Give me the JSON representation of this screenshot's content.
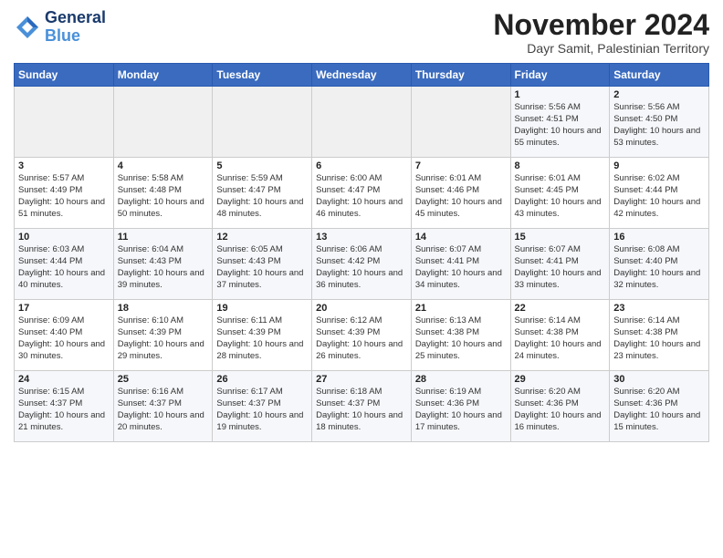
{
  "header": {
    "logo_line1": "General",
    "logo_line2": "Blue",
    "title": "November 2024",
    "subtitle": "Dayr Samit, Palestinian Territory"
  },
  "days_of_week": [
    "Sunday",
    "Monday",
    "Tuesday",
    "Wednesday",
    "Thursday",
    "Friday",
    "Saturday"
  ],
  "weeks": [
    [
      {
        "day": "",
        "info": ""
      },
      {
        "day": "",
        "info": ""
      },
      {
        "day": "",
        "info": ""
      },
      {
        "day": "",
        "info": ""
      },
      {
        "day": "",
        "info": ""
      },
      {
        "day": "1",
        "info": "Sunrise: 5:56 AM\nSunset: 4:51 PM\nDaylight: 10 hours and 55 minutes."
      },
      {
        "day": "2",
        "info": "Sunrise: 5:56 AM\nSunset: 4:50 PM\nDaylight: 10 hours and 53 minutes."
      }
    ],
    [
      {
        "day": "3",
        "info": "Sunrise: 5:57 AM\nSunset: 4:49 PM\nDaylight: 10 hours and 51 minutes."
      },
      {
        "day": "4",
        "info": "Sunrise: 5:58 AM\nSunset: 4:48 PM\nDaylight: 10 hours and 50 minutes."
      },
      {
        "day": "5",
        "info": "Sunrise: 5:59 AM\nSunset: 4:47 PM\nDaylight: 10 hours and 48 minutes."
      },
      {
        "day": "6",
        "info": "Sunrise: 6:00 AM\nSunset: 4:47 PM\nDaylight: 10 hours and 46 minutes."
      },
      {
        "day": "7",
        "info": "Sunrise: 6:01 AM\nSunset: 4:46 PM\nDaylight: 10 hours and 45 minutes."
      },
      {
        "day": "8",
        "info": "Sunrise: 6:01 AM\nSunset: 4:45 PM\nDaylight: 10 hours and 43 minutes."
      },
      {
        "day": "9",
        "info": "Sunrise: 6:02 AM\nSunset: 4:44 PM\nDaylight: 10 hours and 42 minutes."
      }
    ],
    [
      {
        "day": "10",
        "info": "Sunrise: 6:03 AM\nSunset: 4:44 PM\nDaylight: 10 hours and 40 minutes."
      },
      {
        "day": "11",
        "info": "Sunrise: 6:04 AM\nSunset: 4:43 PM\nDaylight: 10 hours and 39 minutes."
      },
      {
        "day": "12",
        "info": "Sunrise: 6:05 AM\nSunset: 4:43 PM\nDaylight: 10 hours and 37 minutes."
      },
      {
        "day": "13",
        "info": "Sunrise: 6:06 AM\nSunset: 4:42 PM\nDaylight: 10 hours and 36 minutes."
      },
      {
        "day": "14",
        "info": "Sunrise: 6:07 AM\nSunset: 4:41 PM\nDaylight: 10 hours and 34 minutes."
      },
      {
        "day": "15",
        "info": "Sunrise: 6:07 AM\nSunset: 4:41 PM\nDaylight: 10 hours and 33 minutes."
      },
      {
        "day": "16",
        "info": "Sunrise: 6:08 AM\nSunset: 4:40 PM\nDaylight: 10 hours and 32 minutes."
      }
    ],
    [
      {
        "day": "17",
        "info": "Sunrise: 6:09 AM\nSunset: 4:40 PM\nDaylight: 10 hours and 30 minutes."
      },
      {
        "day": "18",
        "info": "Sunrise: 6:10 AM\nSunset: 4:39 PM\nDaylight: 10 hours and 29 minutes."
      },
      {
        "day": "19",
        "info": "Sunrise: 6:11 AM\nSunset: 4:39 PM\nDaylight: 10 hours and 28 minutes."
      },
      {
        "day": "20",
        "info": "Sunrise: 6:12 AM\nSunset: 4:39 PM\nDaylight: 10 hours and 26 minutes."
      },
      {
        "day": "21",
        "info": "Sunrise: 6:13 AM\nSunset: 4:38 PM\nDaylight: 10 hours and 25 minutes."
      },
      {
        "day": "22",
        "info": "Sunrise: 6:14 AM\nSunset: 4:38 PM\nDaylight: 10 hours and 24 minutes."
      },
      {
        "day": "23",
        "info": "Sunrise: 6:14 AM\nSunset: 4:38 PM\nDaylight: 10 hours and 23 minutes."
      }
    ],
    [
      {
        "day": "24",
        "info": "Sunrise: 6:15 AM\nSunset: 4:37 PM\nDaylight: 10 hours and 21 minutes."
      },
      {
        "day": "25",
        "info": "Sunrise: 6:16 AM\nSunset: 4:37 PM\nDaylight: 10 hours and 20 minutes."
      },
      {
        "day": "26",
        "info": "Sunrise: 6:17 AM\nSunset: 4:37 PM\nDaylight: 10 hours and 19 minutes."
      },
      {
        "day": "27",
        "info": "Sunrise: 6:18 AM\nSunset: 4:37 PM\nDaylight: 10 hours and 18 minutes."
      },
      {
        "day": "28",
        "info": "Sunrise: 6:19 AM\nSunset: 4:36 PM\nDaylight: 10 hours and 17 minutes."
      },
      {
        "day": "29",
        "info": "Sunrise: 6:20 AM\nSunset: 4:36 PM\nDaylight: 10 hours and 16 minutes."
      },
      {
        "day": "30",
        "info": "Sunrise: 6:20 AM\nSunset: 4:36 PM\nDaylight: 10 hours and 15 minutes."
      }
    ]
  ]
}
